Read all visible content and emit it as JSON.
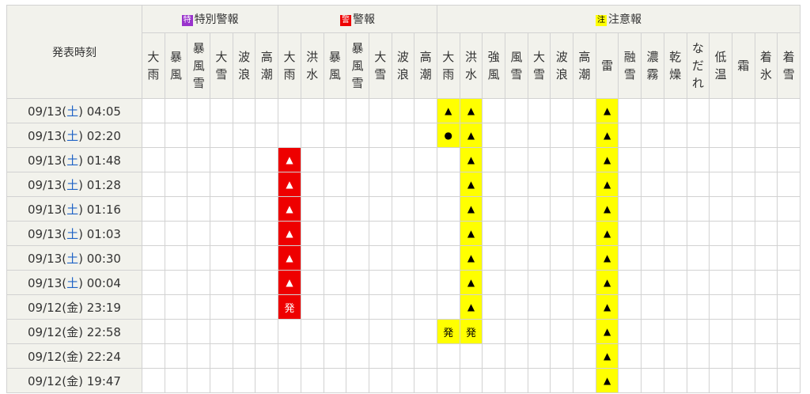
{
  "header": {
    "time_label": "発表時刻",
    "groups": [
      {
        "label": "特別警報",
        "icon": "特",
        "icon_color": "#9933cc"
      },
      {
        "label": "警報",
        "icon": "警",
        "icon_color": "#ee0000"
      },
      {
        "label": "注意報",
        "icon": "注",
        "icon_color": "#ffff00"
      }
    ],
    "cols": [
      [
        "大",
        "雨"
      ],
      [
        "暴",
        "風"
      ],
      [
        "暴",
        "風",
        "雪"
      ],
      [
        "大",
        "雪"
      ],
      [
        "波",
        "浪"
      ],
      [
        "高",
        "潮"
      ],
      [
        "大",
        "雨"
      ],
      [
        "洪",
        "水"
      ],
      [
        "暴",
        "風"
      ],
      [
        "暴",
        "風",
        "雪"
      ],
      [
        "大",
        "雪"
      ],
      [
        "波",
        "浪"
      ],
      [
        "高",
        "潮"
      ],
      [
        "大",
        "雨"
      ],
      [
        "洪",
        "水"
      ],
      [
        "強",
        "風"
      ],
      [
        "風",
        "雪"
      ],
      [
        "大",
        "雪"
      ],
      [
        "波",
        "浪"
      ],
      [
        "高",
        "潮"
      ],
      [
        "雷"
      ],
      [
        "融",
        "雪"
      ],
      [
        "濃",
        "霧"
      ],
      [
        "乾",
        "燥"
      ],
      [
        "な",
        "だ",
        "れ"
      ],
      [
        "低",
        "温"
      ],
      [
        "霜"
      ],
      [
        "着",
        "氷"
      ],
      [
        "着",
        "雪"
      ]
    ]
  },
  "rows": [
    {
      "date": "09/13(",
      "wd": "土",
      "time": ") 04:05",
      "cells": {
        "13": "▲",
        "14": "▲",
        "20": "▲"
      }
    },
    {
      "date": "09/13(",
      "wd": "土",
      "time": ") 02:20",
      "cells": {
        "13": "●",
        "14": "▲",
        "20": "▲"
      }
    },
    {
      "date": "09/13(",
      "wd": "土",
      "time": ") 01:48",
      "cells": {
        "6": "▲",
        "14": "▲",
        "20": "▲"
      }
    },
    {
      "date": "09/13(",
      "wd": "土",
      "time": ") 01:28",
      "cells": {
        "6": "▲",
        "14": "▲",
        "20": "▲"
      }
    },
    {
      "date": "09/13(",
      "wd": "土",
      "time": ") 01:16",
      "cells": {
        "6": "▲",
        "14": "▲",
        "20": "▲"
      }
    },
    {
      "date": "09/13(",
      "wd": "土",
      "time": ") 01:03",
      "cells": {
        "6": "▲",
        "14": "▲",
        "20": "▲"
      }
    },
    {
      "date": "09/13(",
      "wd": "土",
      "time": ") 00:30",
      "cells": {
        "6": "▲",
        "14": "▲",
        "20": "▲"
      }
    },
    {
      "date": "09/13(",
      "wd": "土",
      "time": ") 00:04",
      "cells": {
        "6": "▲",
        "14": "▲",
        "20": "▲"
      }
    },
    {
      "date": "09/12(",
      "wd": "金",
      "time": ") 23:19",
      "cells": {
        "6": "発",
        "14": "▲",
        "20": "▲"
      }
    },
    {
      "date": "09/12(",
      "wd": "金",
      "time": ") 22:58",
      "cells": {
        "13": "発",
        "14": "発",
        "20": "▲"
      }
    },
    {
      "date": "09/12(",
      "wd": "金",
      "time": ") 22:24",
      "cells": {
        "20": "▲"
      }
    },
    {
      "date": "09/12(",
      "wd": "金",
      "time": ") 19:47",
      "cells": {
        "20": "▲"
      }
    }
  ],
  "colors": {
    "keiho": "#ee0000",
    "chuiho": "#ffff00",
    "saturday": "#1f63c6",
    "header_bg": "#f2f2ec"
  }
}
